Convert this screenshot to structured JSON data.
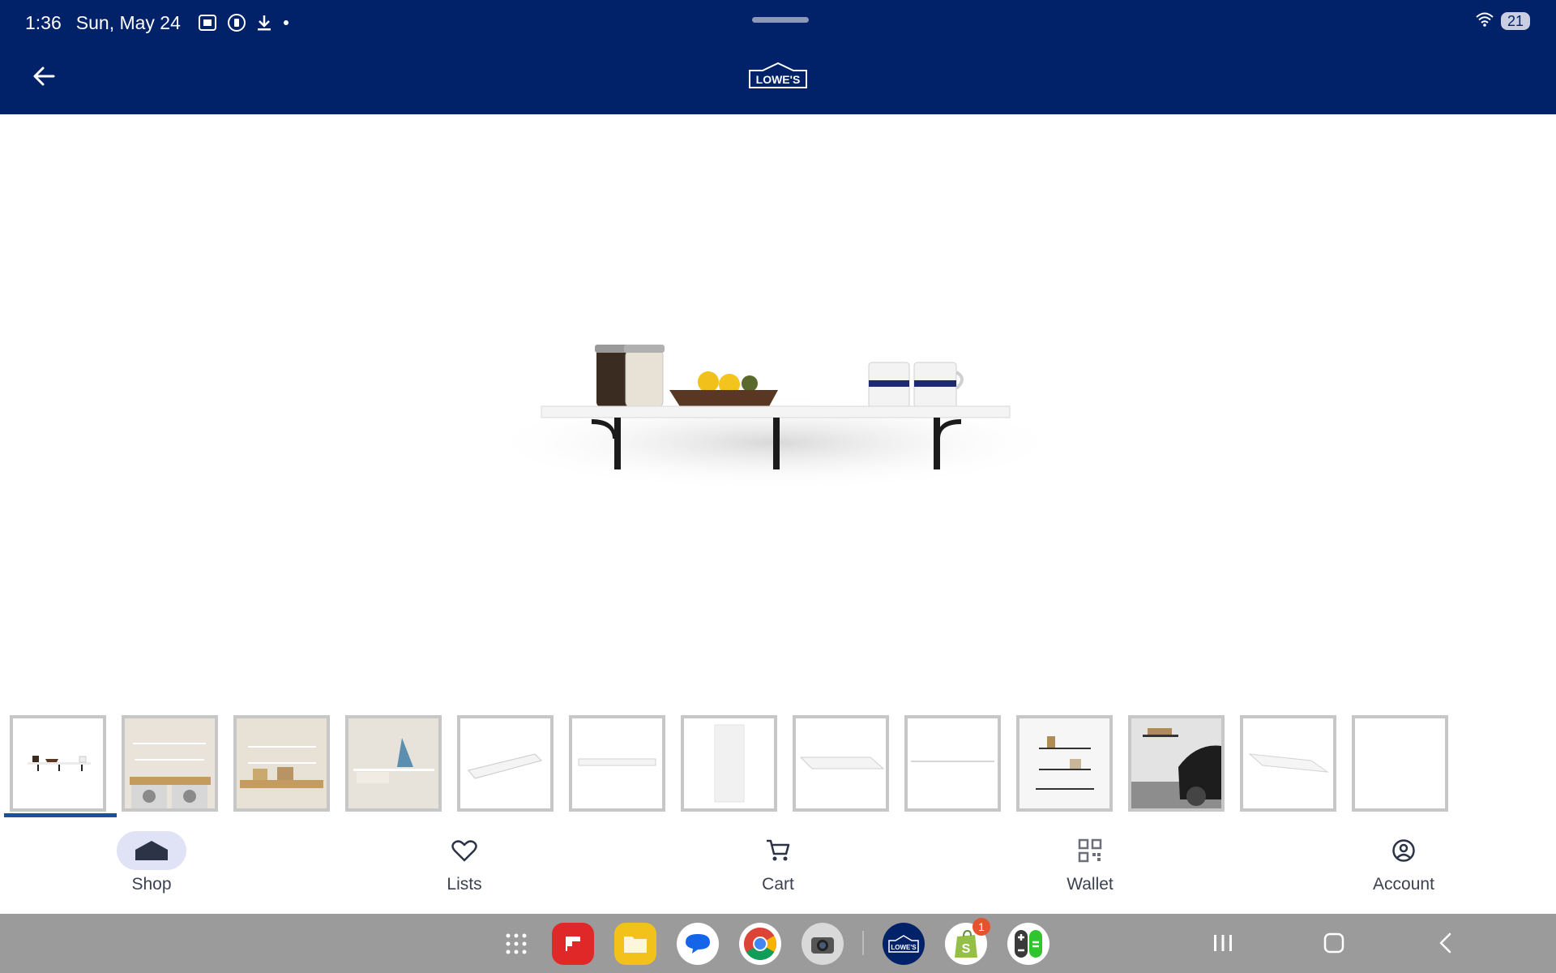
{
  "status_bar": {
    "time": "1:36",
    "date": "Sun, May 24",
    "icons": [
      "screenshot-icon",
      "record-icon",
      "download-icon",
      "notification-dot-icon"
    ],
    "battery": "21"
  },
  "header": {
    "logo_text": "LOWE'S",
    "back_icon": "arrow-left-icon",
    "color": "#012169"
  },
  "gallery": {
    "selected_index": 0,
    "thumbnails": [
      "shelf-with-jars",
      "laundry-room-1",
      "laundry-room-2",
      "laundry-iron",
      "board-angle",
      "board-front",
      "board-vertical",
      "board-angle-2",
      "board-thin",
      "wall-shelves",
      "garage-car",
      "board-angle-3",
      "blank"
    ]
  },
  "bottom_nav": {
    "items": [
      {
        "label": "Shop",
        "icon": "home-icon",
        "active": true
      },
      {
        "label": "Lists",
        "icon": "heart-icon",
        "active": false
      },
      {
        "label": "Cart",
        "icon": "cart-icon",
        "active": false
      },
      {
        "label": "Wallet",
        "icon": "qr-code-icon",
        "active": false
      },
      {
        "label": "Account",
        "icon": "account-icon",
        "active": false
      }
    ]
  },
  "taskbar": {
    "apps": [
      {
        "name": "apps-grid"
      },
      {
        "name": "flipboard"
      },
      {
        "name": "my-files"
      },
      {
        "name": "messages"
      },
      {
        "name": "chrome"
      },
      {
        "name": "camera"
      },
      {
        "name": "lowes",
        "label": "LOWE'S"
      },
      {
        "name": "shopify",
        "badge": "1"
      },
      {
        "name": "calculator"
      }
    ]
  },
  "colors": {
    "brand": "#012169",
    "active_nav": "#dfe3f5",
    "indicator": "#1d4f9c"
  }
}
